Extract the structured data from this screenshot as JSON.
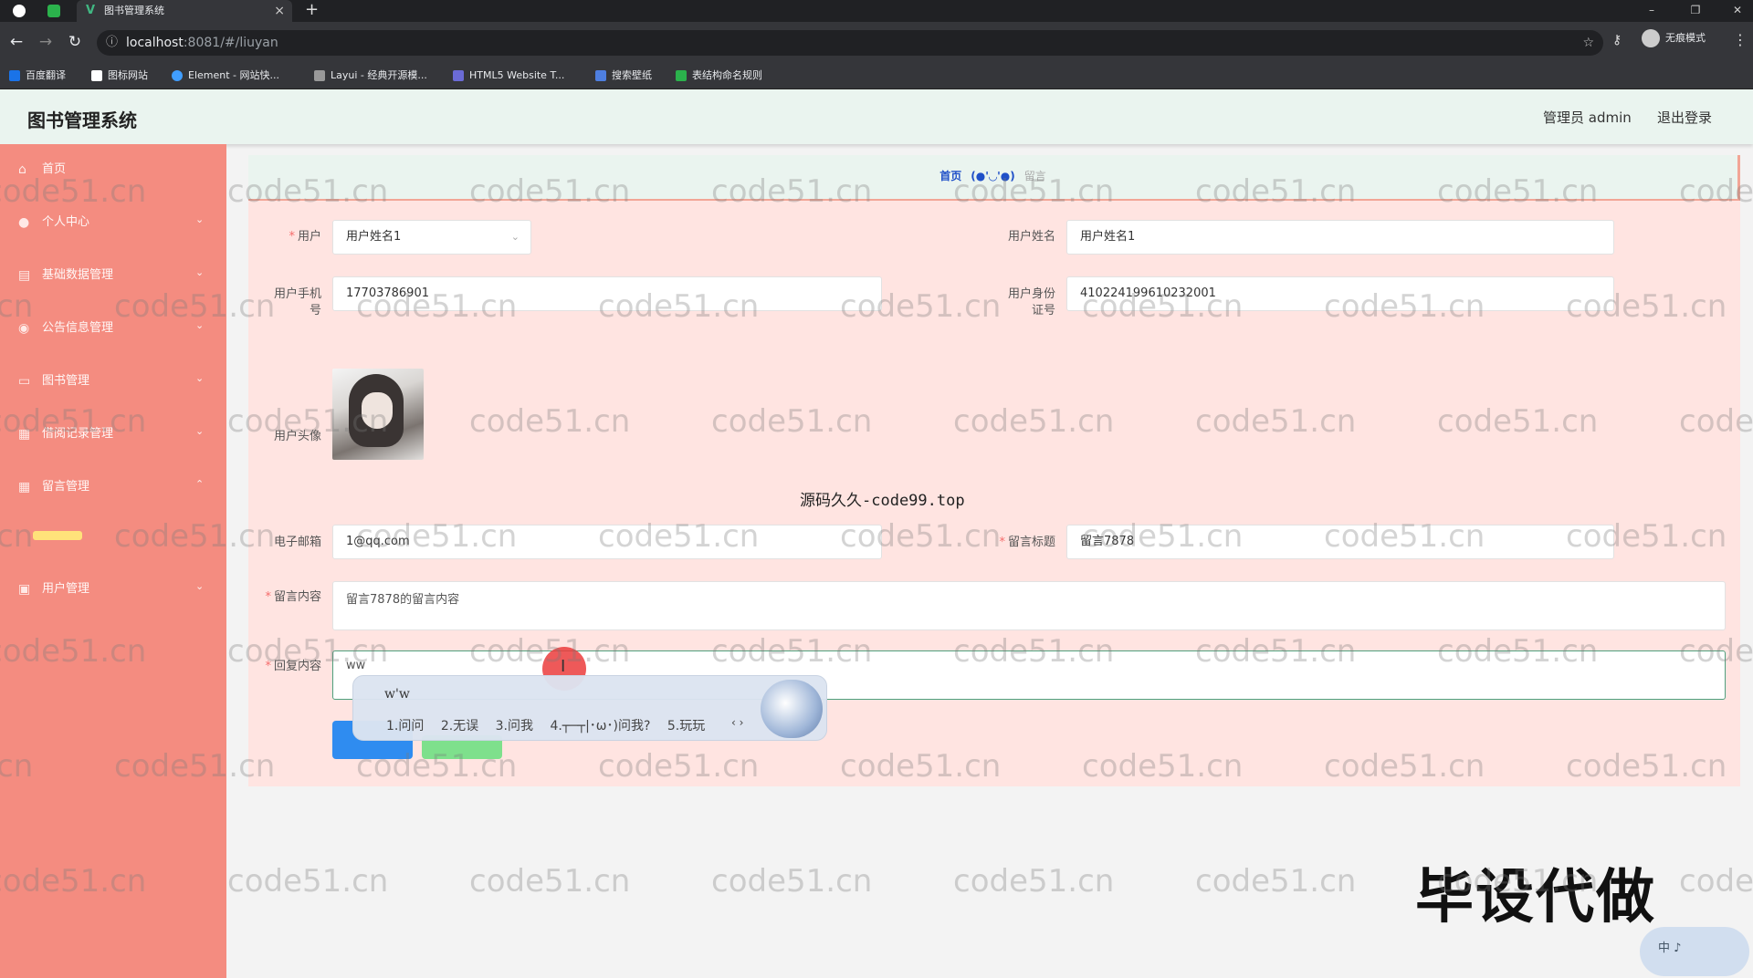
{
  "browser": {
    "tab_title": "图书管理系统",
    "tab_close": "×",
    "new_tab": "+",
    "window_controls": [
      "–",
      "❐",
      "✕"
    ],
    "url_host": "localhost",
    "url_path": ":8081/#/liuyan",
    "profile_label": "无痕模式",
    "bookmarks": [
      "百度翻译",
      "图标网站",
      "Element - 网站快...",
      "Layui - 经典开源模...",
      "HTML5 Website T...",
      "搜索壁纸",
      "表结构命名规则"
    ]
  },
  "header": {
    "title": "图书管理系统",
    "admin": "管理员 admin",
    "logout": "退出登录"
  },
  "sidebar": {
    "items": [
      {
        "label": "首页",
        "icon": "home-icon",
        "arrow": ""
      },
      {
        "label": "个人中心",
        "icon": "user-icon",
        "arrow": "⌄"
      },
      {
        "label": "基础数据管理",
        "icon": "database-icon",
        "arrow": "⌄"
      },
      {
        "label": "公告信息管理",
        "icon": "bulb-icon",
        "arrow": "⌄"
      },
      {
        "label": "图书管理",
        "icon": "book-icon",
        "arrow": "⌄"
      },
      {
        "label": "借阅记录管理",
        "icon": "grid-icon",
        "arrow": "⌄"
      },
      {
        "label": "留言管理",
        "icon": "table-icon",
        "arrow": "⌃"
      },
      {
        "label": "用户管理",
        "icon": "user-manage-icon",
        "arrow": "⌄"
      }
    ]
  },
  "breadcrumb": {
    "home": "首页",
    "separator": "(●'◡'●)",
    "current": "留言"
  },
  "form": {
    "user_label": "用户",
    "user_value": "用户姓名1",
    "user_name_label": "用户姓名",
    "user_name_value": "用户姓名1",
    "phone_label_line1": "用户手机",
    "phone_label_line2": "号",
    "phone_value": "17703786901",
    "id_label_line1": "用户身份",
    "id_label_line2": "证号",
    "id_value": "410224199610232001",
    "avatar_label": "用户头像",
    "email_label": "电子邮箱",
    "email_value": "1@qq.com",
    "title_label": "留言标题",
    "title_value": "留言7878",
    "content_label": "留言内容",
    "content_value": "留言7878的留言内容",
    "reply_label": "回复内容",
    "reply_value": "ww"
  },
  "ime": {
    "composition": "w'w",
    "candidates": [
      "1.问问",
      "2.无误",
      "3.问我",
      "4.┬─┬|･ω･)问我?",
      "5.玩玩"
    ],
    "nav": "‹ ›",
    "status": "中 ♪"
  },
  "overlay": {
    "code99": "源码久久-code99.top",
    "bisheng": "毕设代做",
    "watermark": "code51.cn"
  },
  "colors": {
    "sidebar": "#f48c80",
    "header": "#eaf4ef",
    "card": "#ffe4e1",
    "primary": "#2f8cf0",
    "success": "#7ee08c"
  }
}
